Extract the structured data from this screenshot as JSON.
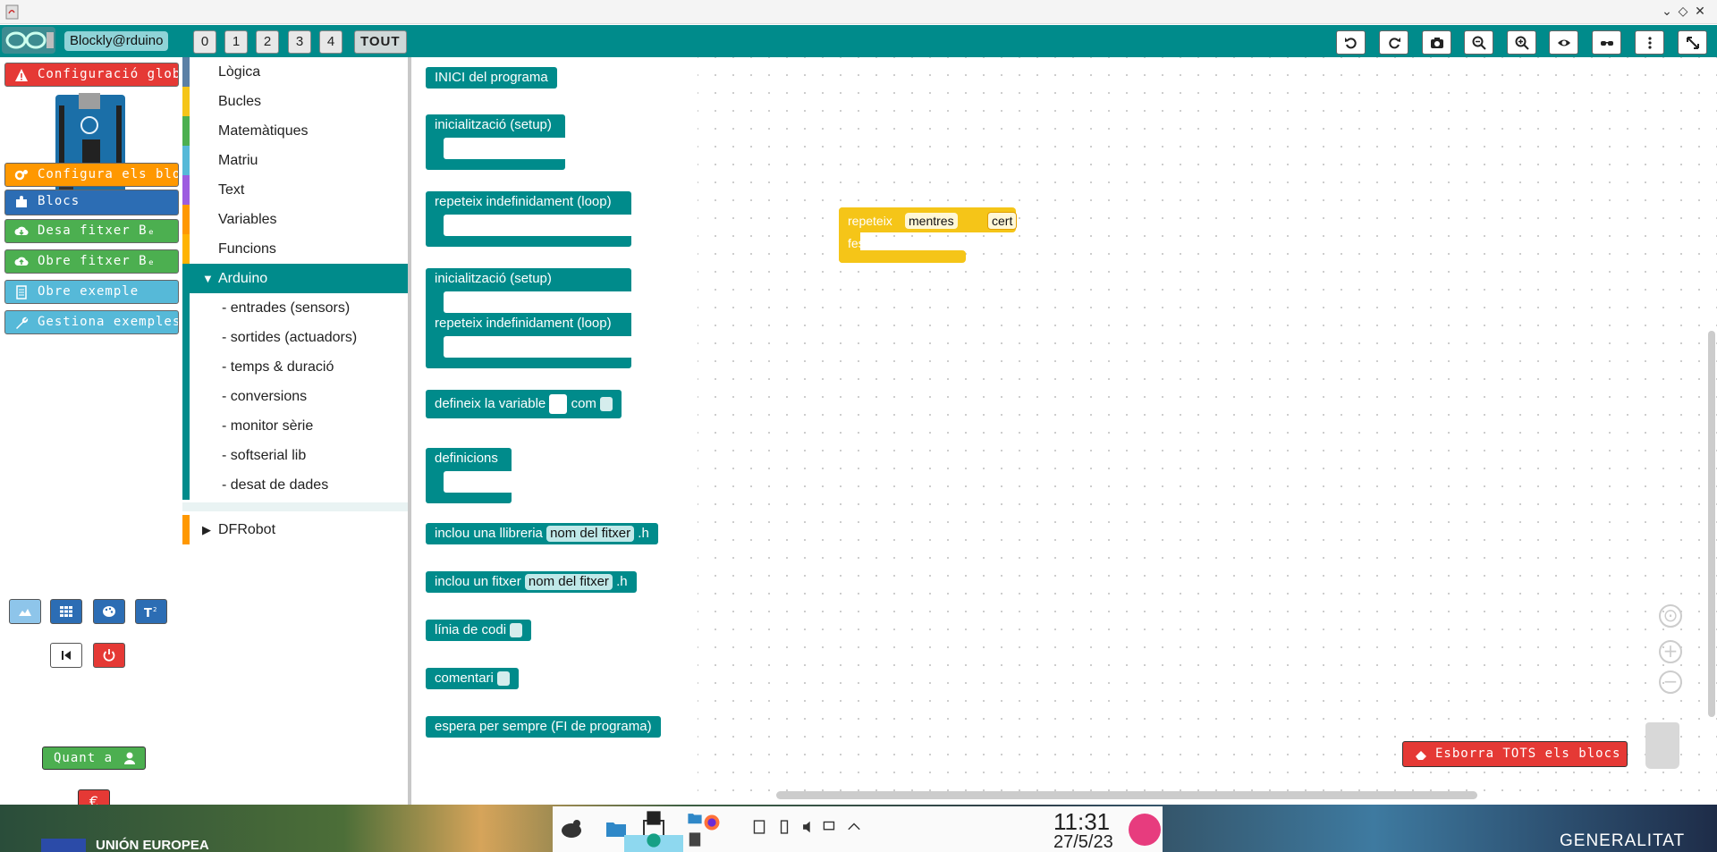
{
  "app": {
    "title": "Blockly@rduino"
  },
  "window_controls": {
    "minimize": "⌄",
    "restore": "◇",
    "close": "✕"
  },
  "tabs": [
    "0",
    "1",
    "2",
    "3",
    "4",
    "TOUT"
  ],
  "toolbar_icons": [
    "undo-icon",
    "redo-icon",
    "camera-icon",
    "zoom-out-icon",
    "zoom-in-icon",
    "eye-icon",
    "glasses-icon",
    "more-vertical-icon",
    "fullscreen-icon"
  ],
  "left_panel": {
    "config_global": "Configuració global",
    "config_blocs": "Configura els blocs",
    "blocs": "Blocs",
    "desa_fitxer": "Desa fitxer Bₑ",
    "obre_fitxer": "Obre fitxer Bₑ",
    "obre_exemple": "Obre exemple",
    "gestiona": "Gestiona exemples",
    "quant_a": "Quant a",
    "euro": "€",
    "colors": {
      "red": "#e53935",
      "orange": "#ff9800",
      "blue": "#2c6db4",
      "green": "#4caf50",
      "cyan": "#56b9d8"
    }
  },
  "toolbox": {
    "categories": [
      {
        "label": "Lògica",
        "color": "#5b80a5"
      },
      {
        "label": "Bucles",
        "color": "#f5c518"
      },
      {
        "label": "Matemàtiques",
        "color": "#4caf50"
      },
      {
        "label": "Matriu",
        "color": "#56b9d8"
      },
      {
        "label": "Text",
        "color": "#9c5ce0"
      },
      {
        "label": "Variables",
        "color": "#ff9800"
      },
      {
        "label": "Funcions",
        "color": "#ffb300"
      }
    ],
    "arduino": "Arduino",
    "subcategories": [
      "- entrades (sensors)",
      "- sortides (actuadors)",
      "- temps & duració",
      "- conversions",
      "- monitor sèrie",
      "- softserial lib",
      "- desat de dades"
    ],
    "dfrobot": "DFRobot",
    "accent": "#008b8b"
  },
  "flyout": {
    "inici": "INICI del programa",
    "setup": "inicialització (setup)",
    "loop": "repeteix indefinidament (loop)",
    "setup2": "inicialització (setup)",
    "loop2": "repeteix indefinidament (loop)",
    "defineix": "defineix la variable",
    "com": "com",
    "definicions": "definicions",
    "inclou_llib": "inclou una llibreria",
    "nom_fitxer": "nom del fitxer",
    "ext_h": ".h",
    "inclou_fitxer": "inclou un fitxer",
    "nom_fitxer2": "nom del fitxer",
    "ext_h2": ".h",
    "linia": "línia de codi",
    "comentari": "comentari",
    "espera": "espera per sempre (FI de programa)"
  },
  "workspace": {
    "repeteix": "repeteix",
    "mentres": "mentres",
    "cert": "cert",
    "fes": "fes",
    "erase_all": "Esborra TOTS els blocs"
  },
  "taskbar": {
    "eu_label": "UNIÓN EUROPEA",
    "generalitat": "GENERALITAT",
    "time": "11:31",
    "date": "27/5/23"
  }
}
